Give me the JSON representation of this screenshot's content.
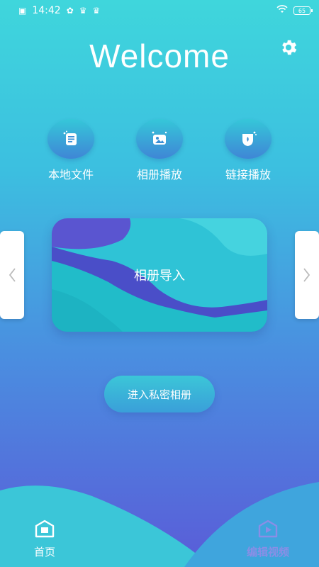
{
  "status_bar": {
    "time": "14:42",
    "battery": "65",
    "icons": [
      "sim-icon",
      "network-icon",
      "crown-icon",
      "crown-icon",
      "wifi-icon",
      "battery-icon"
    ]
  },
  "header": {
    "title": "Welcome",
    "settings_icon": "gear-icon"
  },
  "quick_actions": [
    {
      "label": "本地文件",
      "icon": "document-icon"
    },
    {
      "label": "相册播放",
      "icon": "photo-icon"
    },
    {
      "label": "链接播放",
      "icon": "link-play-icon"
    }
  ],
  "carousel": {
    "active_label": "相册导入",
    "prev_icon": "chevron-left-icon",
    "next_icon": "chevron-right-icon"
  },
  "private_album_button": "进入私密相册",
  "bottom_nav": {
    "items": [
      {
        "label": "首页",
        "icon": "home-icon",
        "active": true
      },
      {
        "label": "编辑视频",
        "icon": "video-edit-icon",
        "active": false
      }
    ]
  },
  "colors": {
    "accent_cyan": "#3fd6dc",
    "accent_purple": "#5a5cd8",
    "card_wave_purple": "#4f54cf"
  }
}
